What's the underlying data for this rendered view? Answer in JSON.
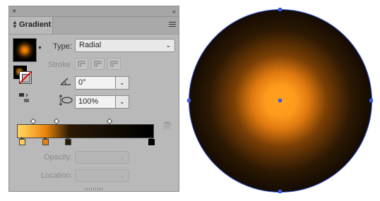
{
  "panel": {
    "close_glyph": "×",
    "collapse_glyph": "‹‹",
    "title": "Gradient",
    "menu_icon": "hamburger-menu-icon"
  },
  "controls": {
    "type_label": "Type:",
    "type_value": "Radial",
    "stroke_label": "Stroke",
    "angle_value": "0°",
    "aspect_value": "100%",
    "opacity_label": "Opacity:",
    "opacity_value": "",
    "location_label": "Location:",
    "location_value": ""
  },
  "icons": {
    "angle": "angle-icon",
    "aspect": "aspect-ratio-icon",
    "reverse": "reverse-gradient-icon",
    "trash": "trash-icon"
  },
  "gradient": {
    "type": "radial",
    "stops": [
      {
        "color": "#ffcc55",
        "location": 0.04
      },
      {
        "color": "#e8820c",
        "location": 0.21
      },
      {
        "color": "#2a1a05",
        "location": 0.38
      },
      {
        "color": "#000000",
        "location": 0.99
      }
    ],
    "midpoints": [
      0.12,
      0.29,
      0.68
    ],
    "selected_stop": 3
  },
  "colors": {
    "panel_bg": "#b9b9b9",
    "selection": "#3a5bd9"
  }
}
